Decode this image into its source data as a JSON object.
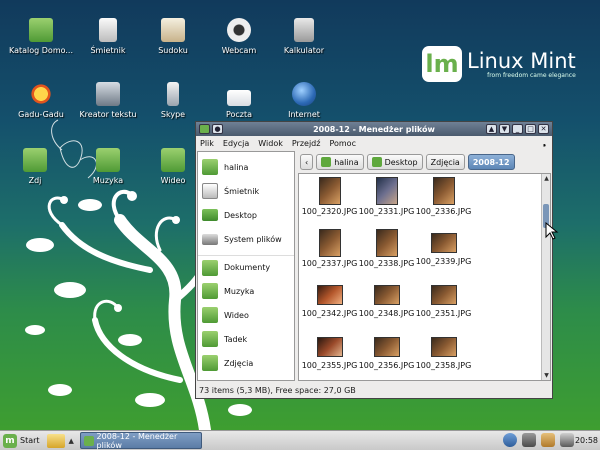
{
  "desktop": {
    "icons": [
      {
        "label": "Katalog Domo..."
      },
      {
        "label": "Śmietnik"
      },
      {
        "label": "Sudoku"
      },
      {
        "label": "Webcam"
      },
      {
        "label": "Kalkulator"
      },
      {
        "label": "Gadu-Gadu"
      },
      {
        "label": "Kreator tekstu"
      },
      {
        "label": "Skype"
      },
      {
        "label": "Poczta"
      },
      {
        "label": "Internet"
      },
      {
        "label": "Zdj"
      },
      {
        "label": "Muzyka"
      },
      {
        "label": "Wideo"
      }
    ],
    "logo": {
      "name": "Linux Mint",
      "tagline": "from freedom came elegance"
    }
  },
  "window": {
    "title": "2008-12 - Menedżer plików",
    "menu": [
      "Plik",
      "Edycja",
      "Widok",
      "Przejdź",
      "Pomoc"
    ],
    "sidebar": [
      "halina",
      "Śmietnik",
      "Desktop",
      "System plików",
      "Dokumenty",
      "Muzyka",
      "Wideo",
      "Tadek",
      "Zdjęcia"
    ],
    "path": [
      "halina",
      "Desktop",
      "Zdjęcia",
      "2008-12"
    ],
    "files": [
      "100_2320.JPG",
      "100_2331.JPG",
      "100_2336.JPG",
      "100_2337.JPG",
      "100_2338.JPG",
      "100_2339.JPG",
      "100_2342.JPG",
      "100_2348.JPG",
      "100_2351.JPG",
      "100_2355.JPG",
      "100_2356.JPG",
      "100_2358.JPG"
    ],
    "status": "73 items (5,3 MB), Free space: 27,0 GB"
  },
  "taskbar": {
    "start_label": "Start",
    "task_label": "2008-12 - Menedżer plików",
    "clock": "20:58"
  },
  "colors": {
    "mint": "#6ab04c",
    "title_bar": "#5a6b80",
    "active_path": "#6d93c2"
  }
}
